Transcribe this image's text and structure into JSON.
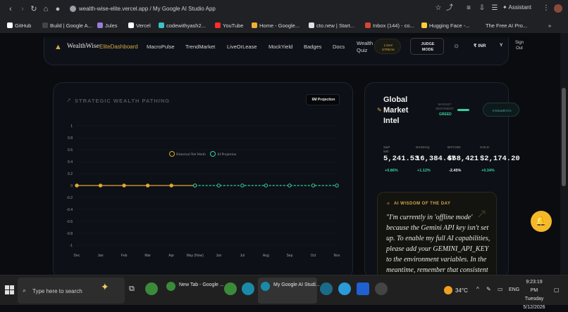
{
  "browser": {
    "url": "wealth-wise-elite.vercel.app / My Google AI Studio App",
    "assistant_label": "Assistant",
    "bookmarks": [
      {
        "label": "GitHub",
        "color": "#ffffff"
      },
      {
        "label": "Build | Google A...",
        "color": "#444444"
      },
      {
        "label": "Jules",
        "color": "#9b7bd8"
      },
      {
        "label": "Vercel",
        "color": "#ffffff"
      },
      {
        "label": "codewithyash2...",
        "color": "#39c3c3"
      },
      {
        "label": "YouTube",
        "color": "#ff2d2d"
      },
      {
        "label": "Home - Google...",
        "color": "#f0b030"
      },
      {
        "label": "cto.new | Start...",
        "color": "#e0e0e0"
      },
      {
        "label": "Inbox (144) - co...",
        "color": "#d44638"
      },
      {
        "label": "Hugging Face -...",
        "color": "#ffcc33"
      },
      {
        "label": "The Free AI Pro...",
        "color": "#202020"
      }
    ]
  },
  "app": {
    "brand": "WealthWise",
    "brand_suffix": "EliteDashboard",
    "nav": [
      "MacroPulse",
      "TrendMarket",
      "LiveOrLease",
      "MockYield",
      "Badges",
      "Docs"
    ],
    "nav_wealth_quiz": [
      "Wealth",
      "Quiz"
    ],
    "streak": [
      "1 DAY",
      "STREAK"
    ],
    "judge_mode": [
      "JUDGE",
      "MODE"
    ],
    "currency": "INR",
    "avatar_letter": "Y",
    "signout": [
      "Sign",
      "Out"
    ]
  },
  "wealth_chart": {
    "title": "STRATEGIC WEALTH PATHING",
    "projection_button": "6M Projection"
  },
  "chart_data": {
    "type": "line",
    "categories": [
      "Dec",
      "Jan",
      "Feb",
      "Mar",
      "Apr",
      "May (Now)",
      "Jun",
      "Jul",
      "Aug",
      "Sep",
      "Oct",
      "Nov"
    ],
    "series": [
      {
        "name": "Historical Net Worth",
        "color": "#e0a82e",
        "values": [
          0,
          0,
          0,
          0,
          0,
          0,
          null,
          null,
          null,
          null,
          null,
          null
        ]
      },
      {
        "name": "AI Projection",
        "color": "#34d399",
        "values": [
          null,
          null,
          null,
          null,
          null,
          0,
          0,
          0,
          0,
          0,
          0,
          0
        ]
      }
    ],
    "yticks": [
      "1",
      "0.8",
      "0.6",
      "0.4",
      "0.2",
      "0",
      "-0.2",
      "-0.4",
      "-0.6",
      "-0.8",
      "-1"
    ],
    "ylim": [
      -1,
      1
    ],
    "legend_position": "top-center",
    "grid": true
  },
  "market": {
    "title": [
      "Global",
      "Market",
      "Intel"
    ],
    "sentiment_label": [
      "MARKET",
      "SENTIMENT"
    ],
    "sentiment_value": "GREED",
    "live_simulation": [
      "LIVE",
      "SIMULATION"
    ],
    "tickers": [
      {
        "name": [
          "S&P",
          "500"
        ],
        "value": "5,241.53",
        "change": "+0.86%",
        "color": "#34d399"
      },
      {
        "name": [
          "NASDAQ"
        ],
        "value": "16,384.47",
        "change": "+1.12%",
        "color": "#34d399"
      },
      {
        "name": [
          "BITCOIN"
        ],
        "value": "$68,421",
        "change": "-2.45%",
        "color": "#f0f0f0"
      },
      {
        "name": [
          "GOLD"
        ],
        "value": "$2,174.20",
        "change": "+0.34%",
        "color": "#34d399"
      }
    ],
    "wisdom_title": "AI WISDOM OF THE DAY",
    "wisdom_text": "\"I'm currently in 'offline mode' because the Gemini API key isn't set up. To enable my full AI capabilities, please add your GEMINI_API_KEY to the environment variables. In the meantime, remember that consistent"
  },
  "taskbar": {
    "search_placeholder": "Type here to search",
    "window1": "New Tab - Google ...",
    "window2": "My Google AI Studi...",
    "temperature": "34°C",
    "lang": "ENG",
    "time": "9:23:19 PM",
    "day": "Tuesday",
    "date": "5/12/2026"
  },
  "colors": {
    "accent_gold": "#e0a82e",
    "accent_green": "#34d399",
    "bell": "#f5b829"
  }
}
